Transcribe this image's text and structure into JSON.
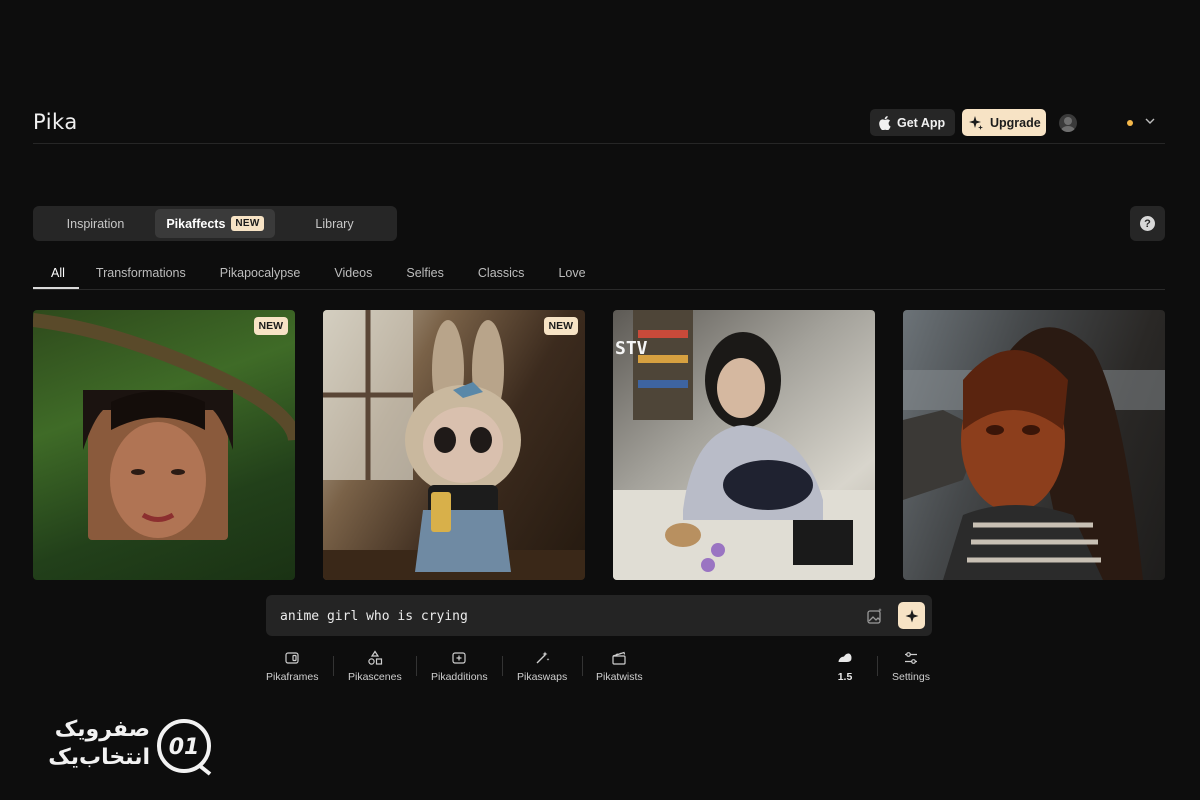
{
  "header": {
    "logo": "Pika",
    "get_app_label": "Get App",
    "upgrade_label": "Upgrade"
  },
  "main_tabs": [
    {
      "label": "Inspiration",
      "active": false
    },
    {
      "label": "Pikaffects",
      "active": true,
      "badge": "NEW"
    },
    {
      "label": "Library",
      "active": false
    }
  ],
  "help": {
    "label": "?"
  },
  "categories": [
    {
      "label": "All",
      "active": true
    },
    {
      "label": "Transformations"
    },
    {
      "label": "Pikapocalypse"
    },
    {
      "label": "Videos"
    },
    {
      "label": "Selfies"
    },
    {
      "label": "Classics"
    },
    {
      "label": "Love"
    }
  ],
  "cards": [
    {
      "badge": "NEW"
    },
    {
      "badge": "NEW"
    },
    {
      "overlay_text": "STV"
    },
    {}
  ],
  "prompt": {
    "value": "anime girl who is crying"
  },
  "tools": [
    {
      "label": "Pikaframes"
    },
    {
      "label": "Pikascenes"
    },
    {
      "label": "Pikadditions"
    },
    {
      "label": "Pikaswaps"
    },
    {
      "label": "Pikatwists"
    }
  ],
  "model": {
    "label": "1.5"
  },
  "settings": {
    "label": "Settings"
  },
  "watermark": {
    "line1": "صفرویک",
    "line2": "انتخاب‌یک",
    "logo_text": "01"
  },
  "colors": {
    "background": "#0d0d0d",
    "accent": "#f7e3c5",
    "notification": "#f5b84a"
  }
}
